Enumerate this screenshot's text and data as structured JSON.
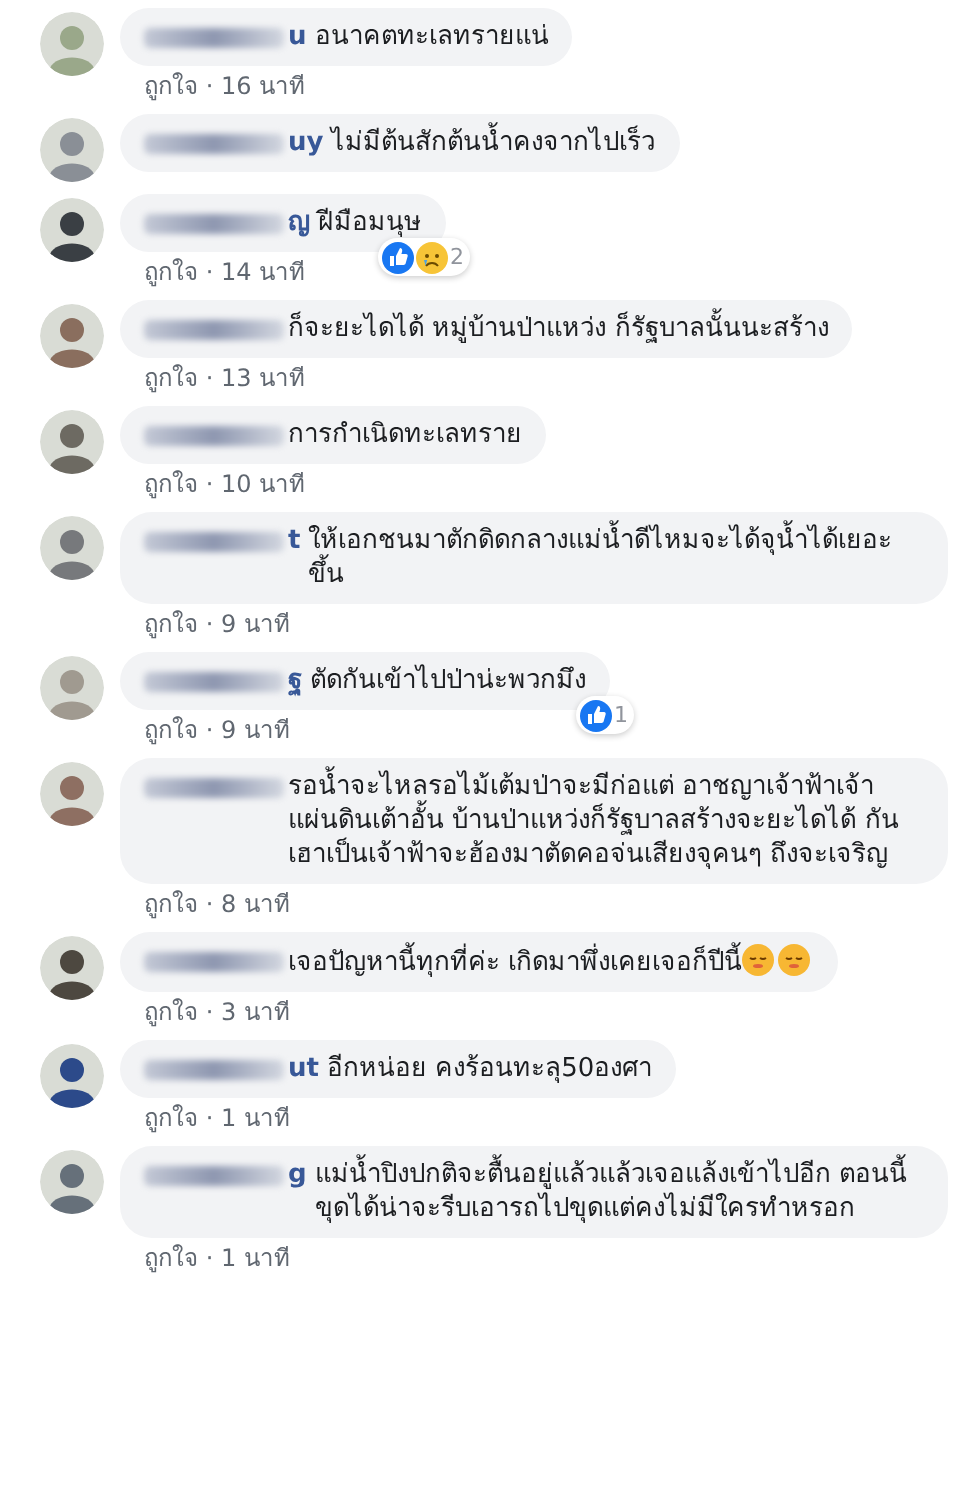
{
  "comments": [
    {
      "name": "u",
      "text": "อนาคตทะเลทรายแน่",
      "meta": "ถูกใจ · 16 นาที"
    },
    {
      "name": "uy",
      "text": "ไม่มีต้นสักต้นน้ำคงจากไปเร็ว"
    },
    {
      "name": "ญ",
      "text": "ฝีมือมนุษ",
      "reactions": {
        "icons": [
          {
            "kind": "like"
          },
          {
            "kind": "sad"
          }
        ],
        "count": "2"
      },
      "meta": "ถูกใจ · 14 นาที"
    },
    {
      "text": "ก็จะยะไดได้ หมู่บ้านป่าแหว่ง ก็รัฐบาลนั้นนะสร้าง",
      "meta": "ถูกใจ · 13 นาที"
    },
    {
      "text": "การกำเนิดทะเลทราย",
      "meta": "ถูกใจ · 10 นาที"
    },
    {
      "name": "t",
      "text": "ให้เอกชนมาตักดิดกลางแม่น้ำดีไหมจะได้จุน้ำได้เยอะขึ้น",
      "meta": "ถูกใจ · 9 นาที"
    },
    {
      "name": "ฐ",
      "text": "ตัดกันเข้าไปป่าน่ะพวกมึง",
      "reactions": {
        "icons": [
          {
            "kind": "like"
          }
        ],
        "count": "1"
      },
      "meta": "ถูกใจ · 9 นาที"
    },
    {
      "text": "รอน้ำจะไหลรอไม้เต้มป่าจะมีก่อแต่ อาชญาเจ้าฟ้าเจ้าแผ่นดินเต้าอั้น บ้านป่าแหว่งก็รัฐบาลสร้างจะยะไดได้ กันเฮาเป็นเจ้าฟ้าจะฮ้องมาตัดคอจ่นเสียงจุคนๆ ถึงจะเจริญ",
      "meta": "ถูกใจ · 8 นาที"
    },
    {
      "text": "เจอปัญหานี้ทุกที่ค่ะ เกิดมาพึ่งเคยเจอก็ปีนี้",
      "emoji": [
        {
          "kind": "pensive"
        },
        {
          "kind": "pensive"
        }
      ],
      "meta": "ถูกใจ · 3 นาที"
    },
    {
      "name": "ut",
      "text": "อีกหน่อย คงร้อนทะลุ50องศา",
      "meta": "ถูกใจ · 1 นาที"
    },
    {
      "name": "g",
      "text": "แม่น้ำปิงปกติจะตื้นอยู่แล้วแล้วเจอแล้งเข้าไปอีก ตอนนี้ขุดได้น่าจะรีบเอารถไปขุดแต่คงไม่มีใครทำหรอก",
      "meta": "ถูกใจ · 1 นาที"
    }
  ]
}
